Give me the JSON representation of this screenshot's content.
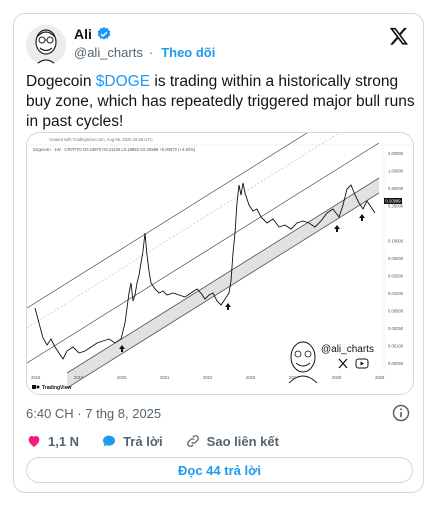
{
  "author": {
    "name": "Ali",
    "handle": "@ali_charts",
    "follow_label": "Theo dõi",
    "separator": "·"
  },
  "tweet": {
    "text_before": "Dogecoin ",
    "cashtag": "$DOGE",
    "text_after": " is trading within a historically strong buy zone, which has repeatedly triggered major bull runs in past cycles!"
  },
  "chart": {
    "created_line": "created with TradingView.com, Aug 06, 2025 15:08 UTC",
    "symbol_line": "Dogecoin · 1W · CRYPTO O0.19970 H0.21105 L0.18983 C0.20989 +0.00970 (+4.84%)",
    "x_ticks": [
      "2018",
      "2019",
      "2020",
      "2021",
      "2022",
      "2023",
      "2024",
      "2025",
      "2026"
    ],
    "y_ticks": [
      "2.00000",
      "1.00000",
      "0.50000",
      "0.25000",
      "0.20989",
      "0.10000",
      "0.05000",
      "0.02500",
      "0.01000",
      "0.00500",
      "0.00250",
      "0.00100",
      "0.00050"
    ],
    "price_label": "0.20989",
    "watermark": "@ali_charts",
    "tv_logo": "TradingView"
  },
  "meta": {
    "timestamp": "6:40 CH · 7 thg 8, 2025"
  },
  "actions": {
    "likes": "1,1 N",
    "reply": "Trả lời",
    "copy_link": "Sao liên kết"
  },
  "replies_button": "Đọc 44 trả lời",
  "colors": {
    "accent": "#1d9bf0",
    "like": "#f91880",
    "text": "#0f1419",
    "muted": "#536471"
  }
}
